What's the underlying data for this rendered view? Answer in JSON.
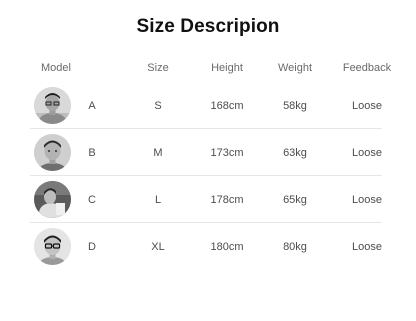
{
  "title": "Size Descripion",
  "headers": {
    "model": "Model",
    "size": "Size",
    "height": "Height",
    "weight": "Weight",
    "feedback": "Feedback"
  },
  "rows": [
    {
      "model": "A",
      "size": "S",
      "height": "168cm",
      "weight": "58kg",
      "feedback": "Loose",
      "avatar_icon": "person-photo-icon"
    },
    {
      "model": "B",
      "size": "M",
      "height": "173cm",
      "weight": "63kg",
      "feedback": "Loose",
      "avatar_icon": "person-photo-icon"
    },
    {
      "model": "C",
      "size": "L",
      "height": "178cm",
      "weight": "65kg",
      "feedback": "Loose",
      "avatar_icon": "person-photo-icon"
    },
    {
      "model": "D",
      "size": "XL",
      "height": "180cm",
      "weight": "80kg",
      "feedback": "Loose",
      "avatar_icon": "person-photo-icon"
    }
  ]
}
